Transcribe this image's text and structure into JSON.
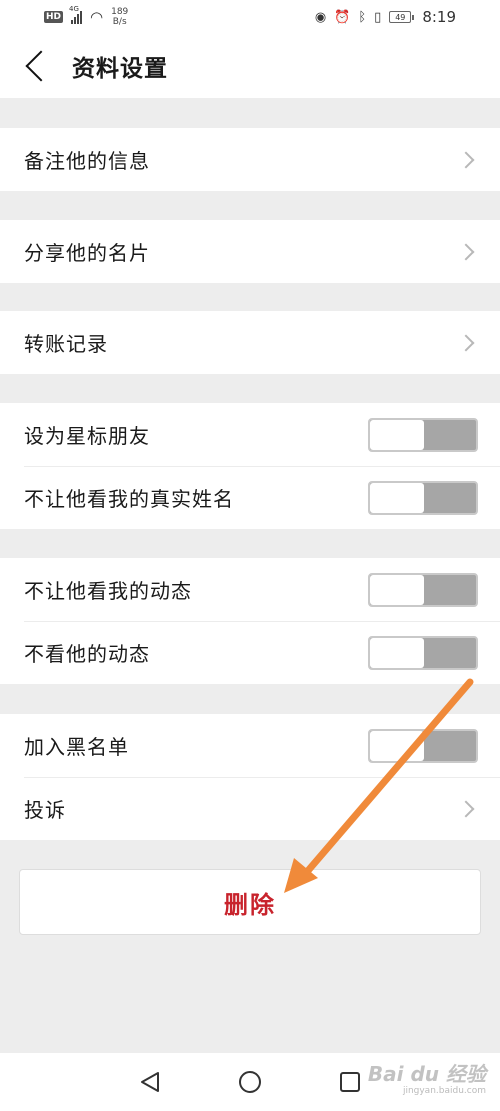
{
  "status_bar": {
    "hd": "HD",
    "network": "4G",
    "speed_value": "189",
    "speed_unit": "B/s",
    "battery": "49",
    "time": "8:19"
  },
  "header": {
    "title": "资料设置"
  },
  "groups": {
    "remark": {
      "label": "备注他的信息"
    },
    "share_card": {
      "label": "分享他的名片"
    },
    "transfer_records": {
      "label": "转账记录"
    },
    "star_friend": {
      "label": "设为星标朋友",
      "on": false
    },
    "hide_real_name": {
      "label": "不让他看我的真实姓名",
      "on": false
    },
    "hide_my_moments": {
      "label": "不让他看我的动态",
      "on": false
    },
    "mute_his_moments": {
      "label": "不看他的动态",
      "on": false
    },
    "blacklist": {
      "label": "加入黑名单",
      "on": false
    },
    "report": {
      "label": "投诉"
    }
  },
  "delete_label": "删除",
  "watermark": {
    "main": "Bai du 经验",
    "sub": "jingyan.baidu.com"
  },
  "colors": {
    "delete_text": "#c8232c",
    "arrow": "#f08a3a",
    "toggle_off_track": "#a6a6a6",
    "background": "#ededed"
  }
}
